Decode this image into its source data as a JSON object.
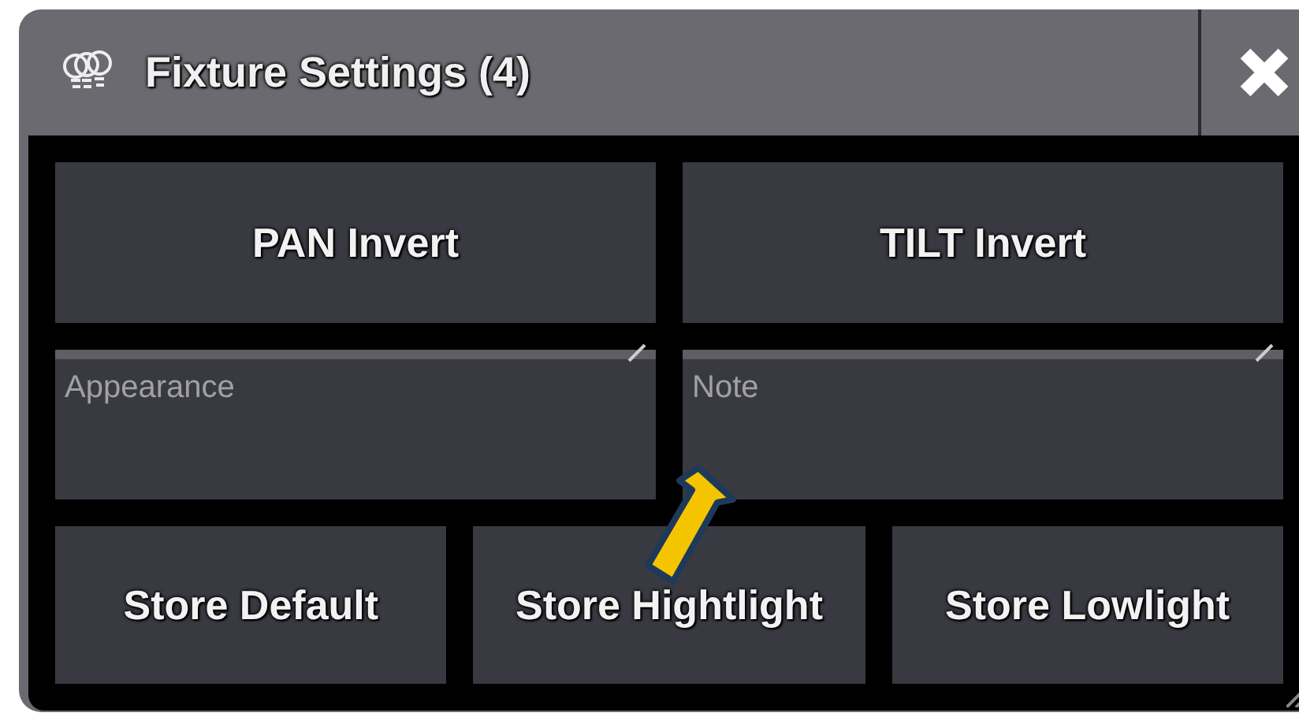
{
  "window": {
    "title": "Fixture Settings (4)"
  },
  "buttons_top": [
    "PAN Invert",
    "TILT Invert"
  ],
  "fields": [
    {
      "placeholder": "Appearance"
    },
    {
      "placeholder": "Note"
    }
  ],
  "buttons_bottom": [
    "Store Default",
    "Store Hightlight",
    "Store Lowlight"
  ]
}
